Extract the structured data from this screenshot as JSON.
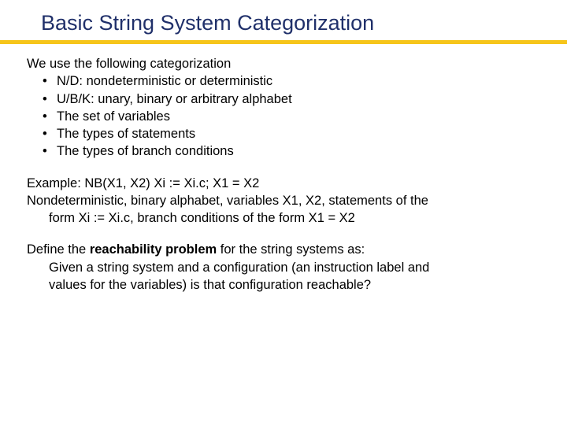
{
  "title": "Basic String System Categorization",
  "intro": "We use the following categorization",
  "bullets": [
    "N/D: nondeterministic or deterministic",
    "U/B/K: unary, binary or arbitrary alphabet",
    "The set of variables",
    "The types of statements",
    "The types of branch conditions"
  ],
  "example": {
    "line1": "Example: NB(X1, X2) Xi := Xi.c; X1 = X2",
    "line2": "Nondeterministic, binary alphabet, variables X1, X2, statements of the",
    "line3": "form Xi := Xi.c, branch conditions of the form X1 = X2"
  },
  "reach": {
    "prefix": "Define the ",
    "bold": "reachability problem",
    "suffix": " for the string systems as:",
    "line2": "Given a string system and a configuration (an instruction label and",
    "line3": "values for the variables) is that configuration reachable?"
  }
}
